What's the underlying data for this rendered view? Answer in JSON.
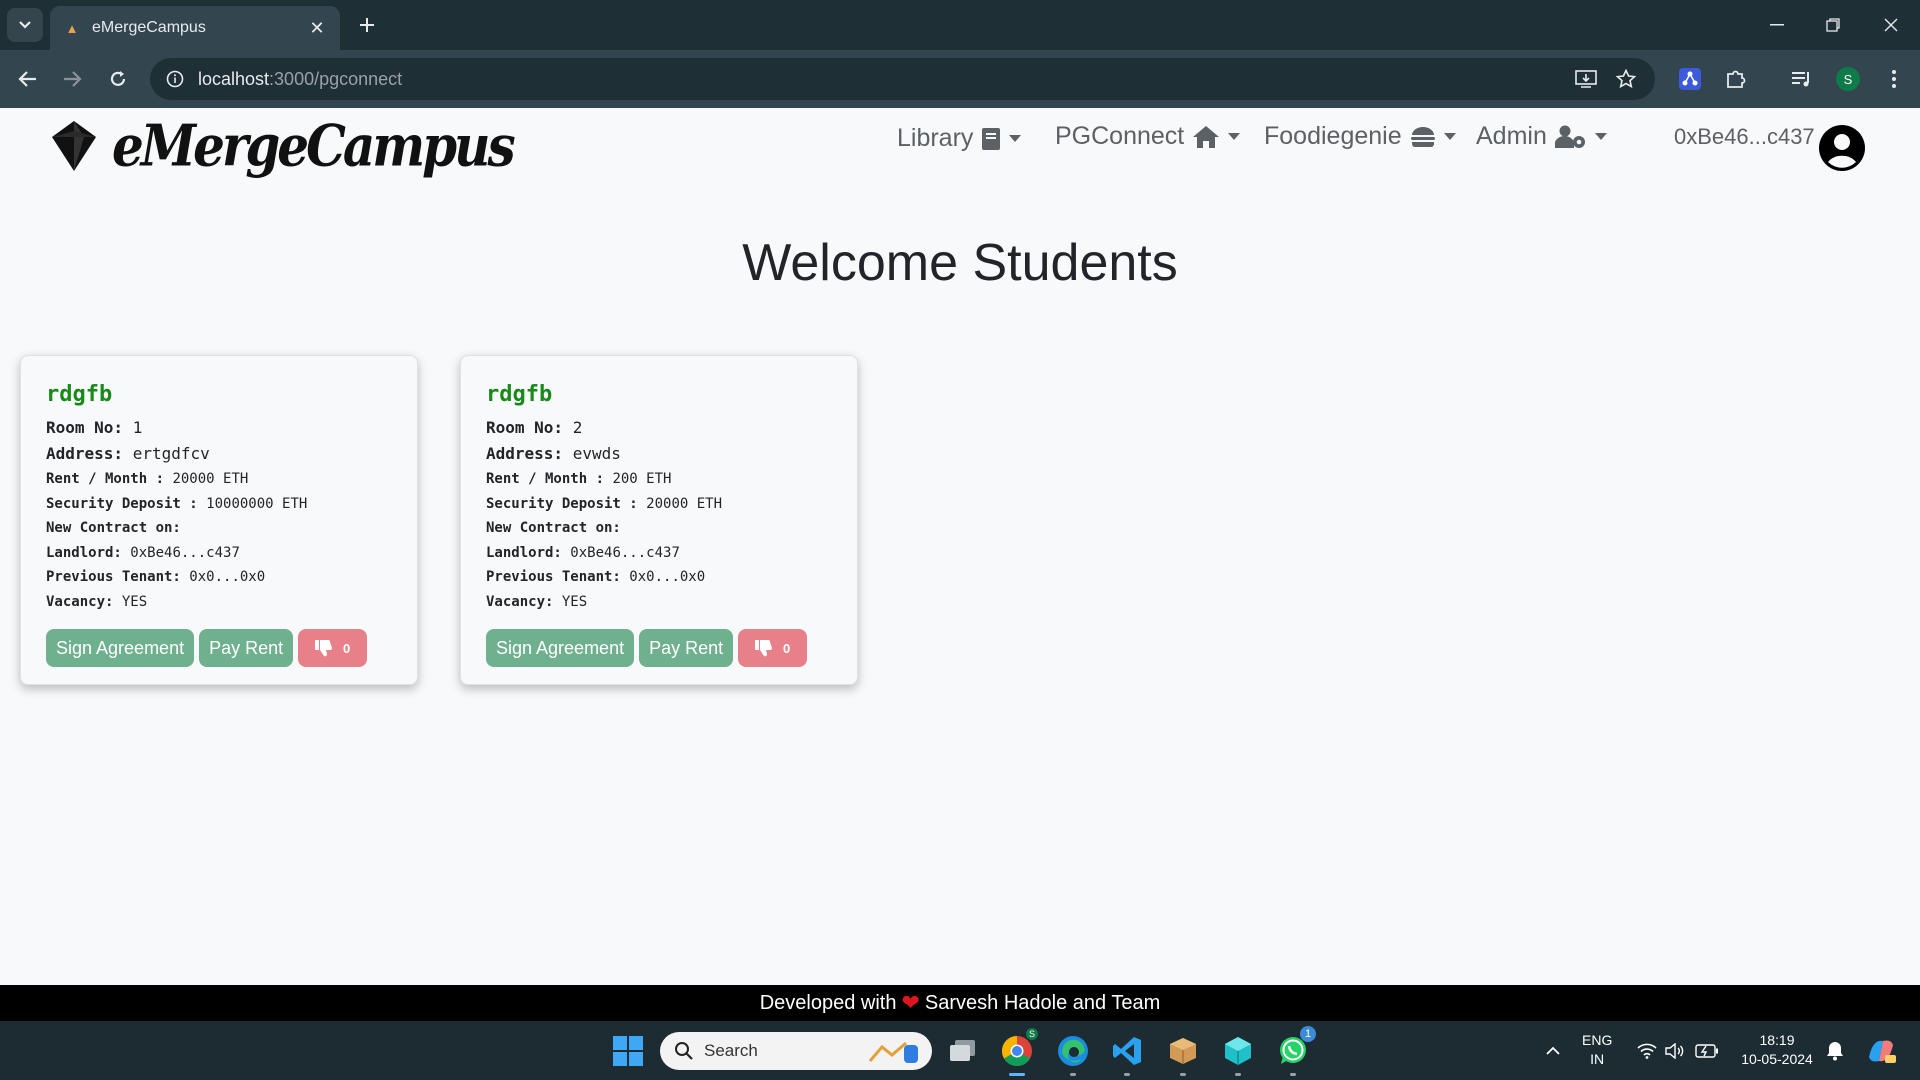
{
  "browser": {
    "tab_title": "eMergeCampus",
    "url_host": "localhost",
    "url_path": ":3000/pgconnect"
  },
  "header": {
    "brand": "eMergeCampus",
    "nav": [
      {
        "label": "Library",
        "icon": "book-icon"
      },
      {
        "label": "PGConnect",
        "icon": "home-icon"
      },
      {
        "label": "Foodiegenie",
        "icon": "burger-icon"
      },
      {
        "label": "Admin",
        "icon": "user-cog-icon"
      }
    ],
    "account": "0xBe46...c437"
  },
  "main": {
    "title": "Welcome Students",
    "cards": [
      {
        "name": "rdgfb",
        "room_label": "Room No:",
        "room": "1",
        "address_label": "Address:",
        "address": "ertgdfcv",
        "rent_label": "Rent / Month :",
        "rent": "20000 ETH",
        "deposit_label": "Security Deposit :",
        "deposit": "10000000 ETH",
        "contract_label": "New Contract on:",
        "landlord_label": "Landlord:",
        "landlord": "0xBe46...c437",
        "tenant_label": "Previous Tenant:",
        "tenant": "0x0...0x0",
        "vacancy_label": "Vacancy:",
        "vacancy": "YES",
        "sign_label": "Sign Agreement",
        "pay_label": "Pay Rent",
        "dislikes": "0"
      },
      {
        "name": "rdgfb",
        "room_label": "Room No:",
        "room": "2",
        "address_label": "Address:",
        "address": "evwds",
        "rent_label": "Rent / Month :",
        "rent": "200 ETH",
        "deposit_label": "Security Deposit :",
        "deposit": "20000 ETH",
        "contract_label": "New Contract on:",
        "landlord_label": "Landlord:",
        "landlord": "0xBe46...c437",
        "tenant_label": "Previous Tenant:",
        "tenant": "0x0...0x0",
        "vacancy_label": "Vacancy:",
        "vacancy": "YES",
        "sign_label": "Sign Agreement",
        "pay_label": "Pay Rent",
        "dislikes": "0"
      }
    ]
  },
  "footer": {
    "prefix": "Developed with",
    "heart": "❤",
    "suffix": "Sarvesh Hadole and Team"
  },
  "taskbar": {
    "search": "Search",
    "lang_line1": "ENG",
    "lang_line2": "IN",
    "time": "18:19",
    "date": "10-05-2024",
    "whatsapp_badge": "1",
    "chrome_badge": "S"
  },
  "colors": {
    "accent_green": "#6fb08f",
    "dislike_red": "#e8808a",
    "name_green": "#198a19"
  }
}
